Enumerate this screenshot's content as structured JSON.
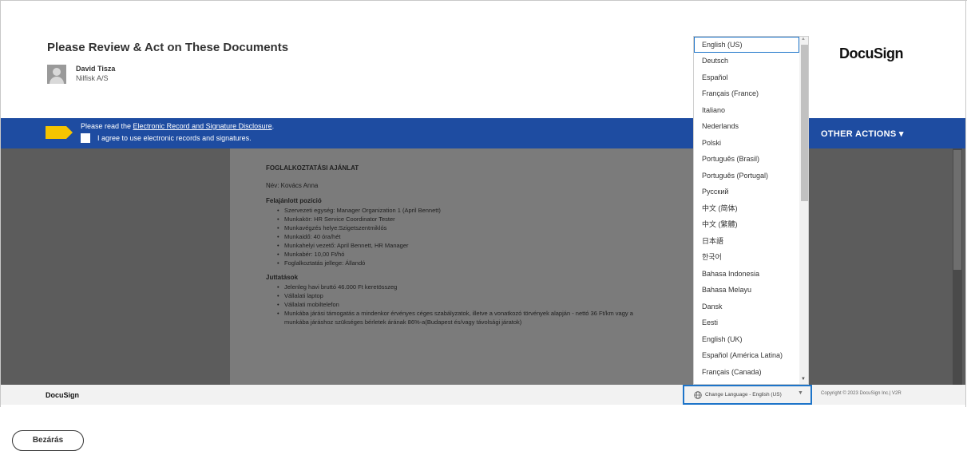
{
  "header": {
    "title": "Please Review & Act on These Documents",
    "sender_name": "David Tisza",
    "sender_org": "Nilfisk A/S",
    "logo": "DocuSign"
  },
  "banner": {
    "disclosure_prefix": "Please read the ",
    "disclosure_link": "Electronic Record and Signature Disclosure",
    "disclosure_suffix": ".",
    "agree_label": "I agree to use electronic records and signatures.",
    "agree_checked": false,
    "other_actions": "OTHER ACTIONS ▾",
    "color": "#1e4ca1",
    "tag_icon_color": "#f5c400",
    "tag_icon": "tag-icon"
  },
  "document": {
    "heading": "FOGLALKOZTATÁSI AJÁNLAT",
    "name_line": "Név: Kovács Anna",
    "sections": [
      {
        "title": "Felajánlott pozíció",
        "items": [
          "Szervezeti egység: Manager Organization 1 (April Bennett)",
          "Munkakör: HR Service Coordinator Tester",
          "Munkavégzés helye:Szigetszentmiklós",
          "Munkaidő: 40 óra/hét",
          "Munkahelyi vezető: April Bennett, HR Manager",
          "Munkabér: 10,00 Ft/hó",
          "Foglalkoztatás jellege: Állandó"
        ]
      },
      {
        "title": "Juttatások",
        "items": [
          "Jelenleg havi bruttó 46.000 Ft keretösszeg",
          "Vállalati laptop",
          "Vállalati mobiltelefon",
          "Munkába járási támogatás a mindenkor érvényes céges szabályzatok, illetve a vonatkozó törvények alapján - nettó 36 Ft/km vagy a munkába járáshoz szükséges bérletek árának 86%-a(Budapest és/vagy távolsági járatok)"
        ]
      }
    ]
  },
  "language_dropdown": {
    "selected": "English (US)",
    "options": [
      "English (US)",
      "Deutsch",
      "Español",
      "Français (France)",
      "Italiano",
      "Nederlands",
      "Polski",
      "Português (Brasil)",
      "Português (Portugal)",
      "Русский",
      "中文 (简体)",
      "中文 (繁體)",
      "日本語",
      "한국어",
      "Bahasa Indonesia",
      "Bahasa Melayu",
      "Dansk",
      "Eesti",
      "English (UK)",
      "Español (América Latina)",
      "Français (Canada)"
    ]
  },
  "footer": {
    "logo": "DocuSign",
    "change_language": "Change Language - English (US)",
    "lang_icon": "globe-icon",
    "caret_icon": "caret-down-icon",
    "copyright": "Copyright © 2023 DocuSign Inc.| V2R",
    "focus_color": "#1d74c9"
  },
  "actions": {
    "close_label": "Bezárás"
  }
}
